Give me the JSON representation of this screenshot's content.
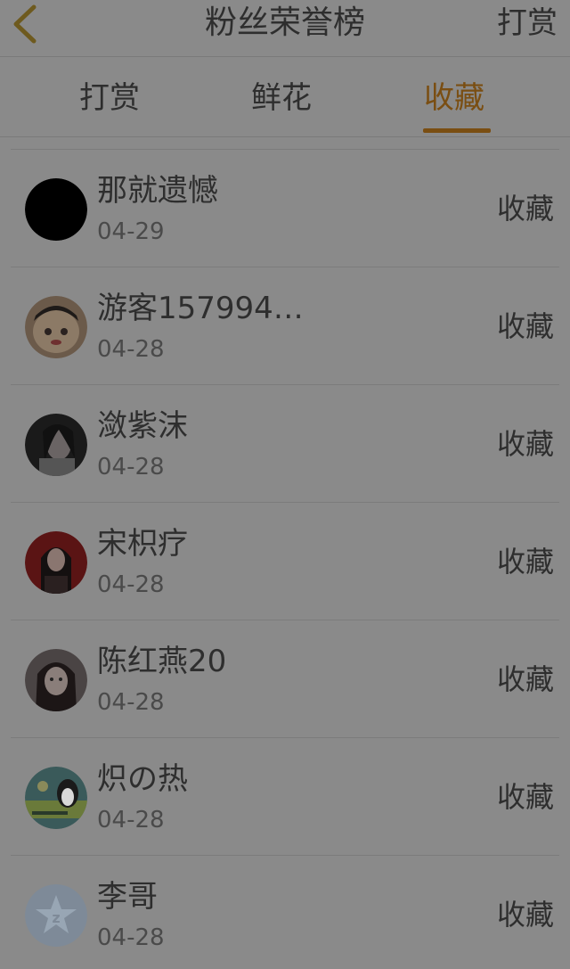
{
  "header": {
    "title": "粉丝荣誉榜",
    "action_label": "打赏"
  },
  "tabs": [
    {
      "label": "打赏"
    },
    {
      "label": "鲜花"
    },
    {
      "label": "收藏",
      "active": true
    }
  ],
  "colors": {
    "accent": "#7a4e12",
    "background": "#8a8a8a"
  },
  "fans": [
    {
      "name": "那就遗憾",
      "date": "04-29",
      "action": "收藏",
      "avatar": "black-circle-avatar"
    },
    {
      "name": "游客157994…",
      "date": "04-28",
      "action": "收藏",
      "avatar": "cartoon-avatar"
    },
    {
      "name": "潋紫沫",
      "date": "04-28",
      "action": "收藏",
      "avatar": "photo-avatar"
    },
    {
      "name": "宋枳疗",
      "date": "04-28",
      "action": "收藏",
      "avatar": "photo-avatar"
    },
    {
      "name": "陈红燕20",
      "date": "04-28",
      "action": "收藏",
      "avatar": "photo-avatar"
    },
    {
      "name": "炽の热",
      "date": "04-28",
      "action": "收藏",
      "avatar": "penguin-avatar"
    },
    {
      "name": "李哥",
      "date": "04-28",
      "action": "收藏",
      "avatar": "default-star-avatar"
    }
  ]
}
